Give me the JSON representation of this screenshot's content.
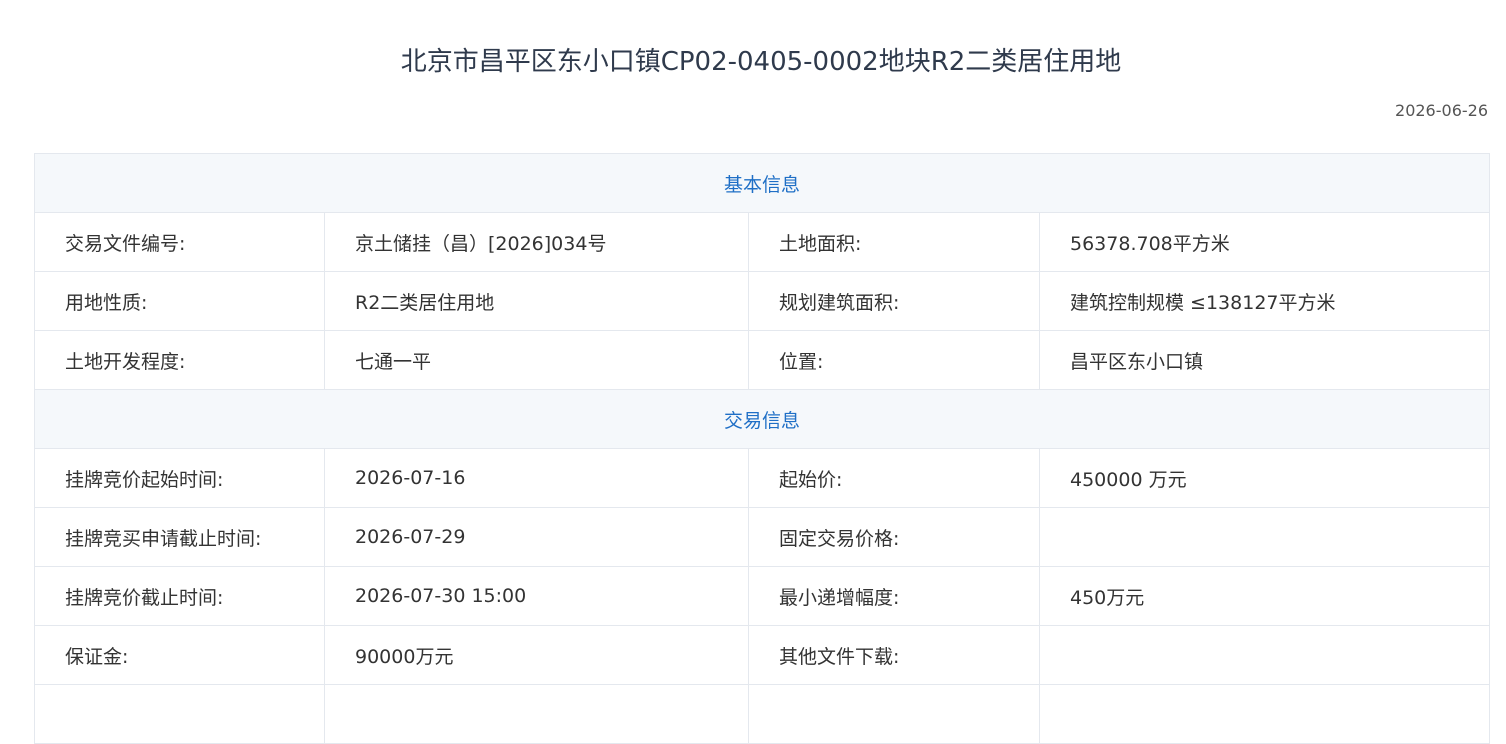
{
  "page": {
    "title": "北京市昌平区东小口镇CP02-0405-0002地块R2二类居住用地",
    "date": "2026-06-26"
  },
  "sections": {
    "basic": {
      "title": "基本信息",
      "rows": [
        {
          "label1": "交易文件编号:",
          "value1": "京土储挂（昌）[2026]034号",
          "label2": "土地面积:",
          "value2": "56378.708平方米"
        },
        {
          "label1": "用地性质:",
          "value1": "R2二类居住用地",
          "label2": "规划建筑面积:",
          "value2": "建筑控制规模 ≤138127平方米"
        },
        {
          "label1": "土地开发程度:",
          "value1": "七通一平",
          "label2": "位置:",
          "value2": "昌平区东小口镇"
        }
      ]
    },
    "trade": {
      "title": "交易信息",
      "rows": [
        {
          "label1": "挂牌竞价起始时间:",
          "value1": "2026-07-16",
          "label2": "起始价:",
          "value2": "450000 万元"
        },
        {
          "label1": "挂牌竞买申请截止时间:",
          "value1": "2026-07-29",
          "label2": "固定交易价格:",
          "value2": ""
        },
        {
          "label1": "挂牌竞价截止时间:",
          "value1": "2026-07-30 15:00",
          "label2": "最小递增幅度:",
          "value2": "450万元"
        },
        {
          "label1": "保证金:",
          "value1": "90000万元",
          "label2": "其他文件下载:",
          "value2": ""
        }
      ]
    }
  }
}
